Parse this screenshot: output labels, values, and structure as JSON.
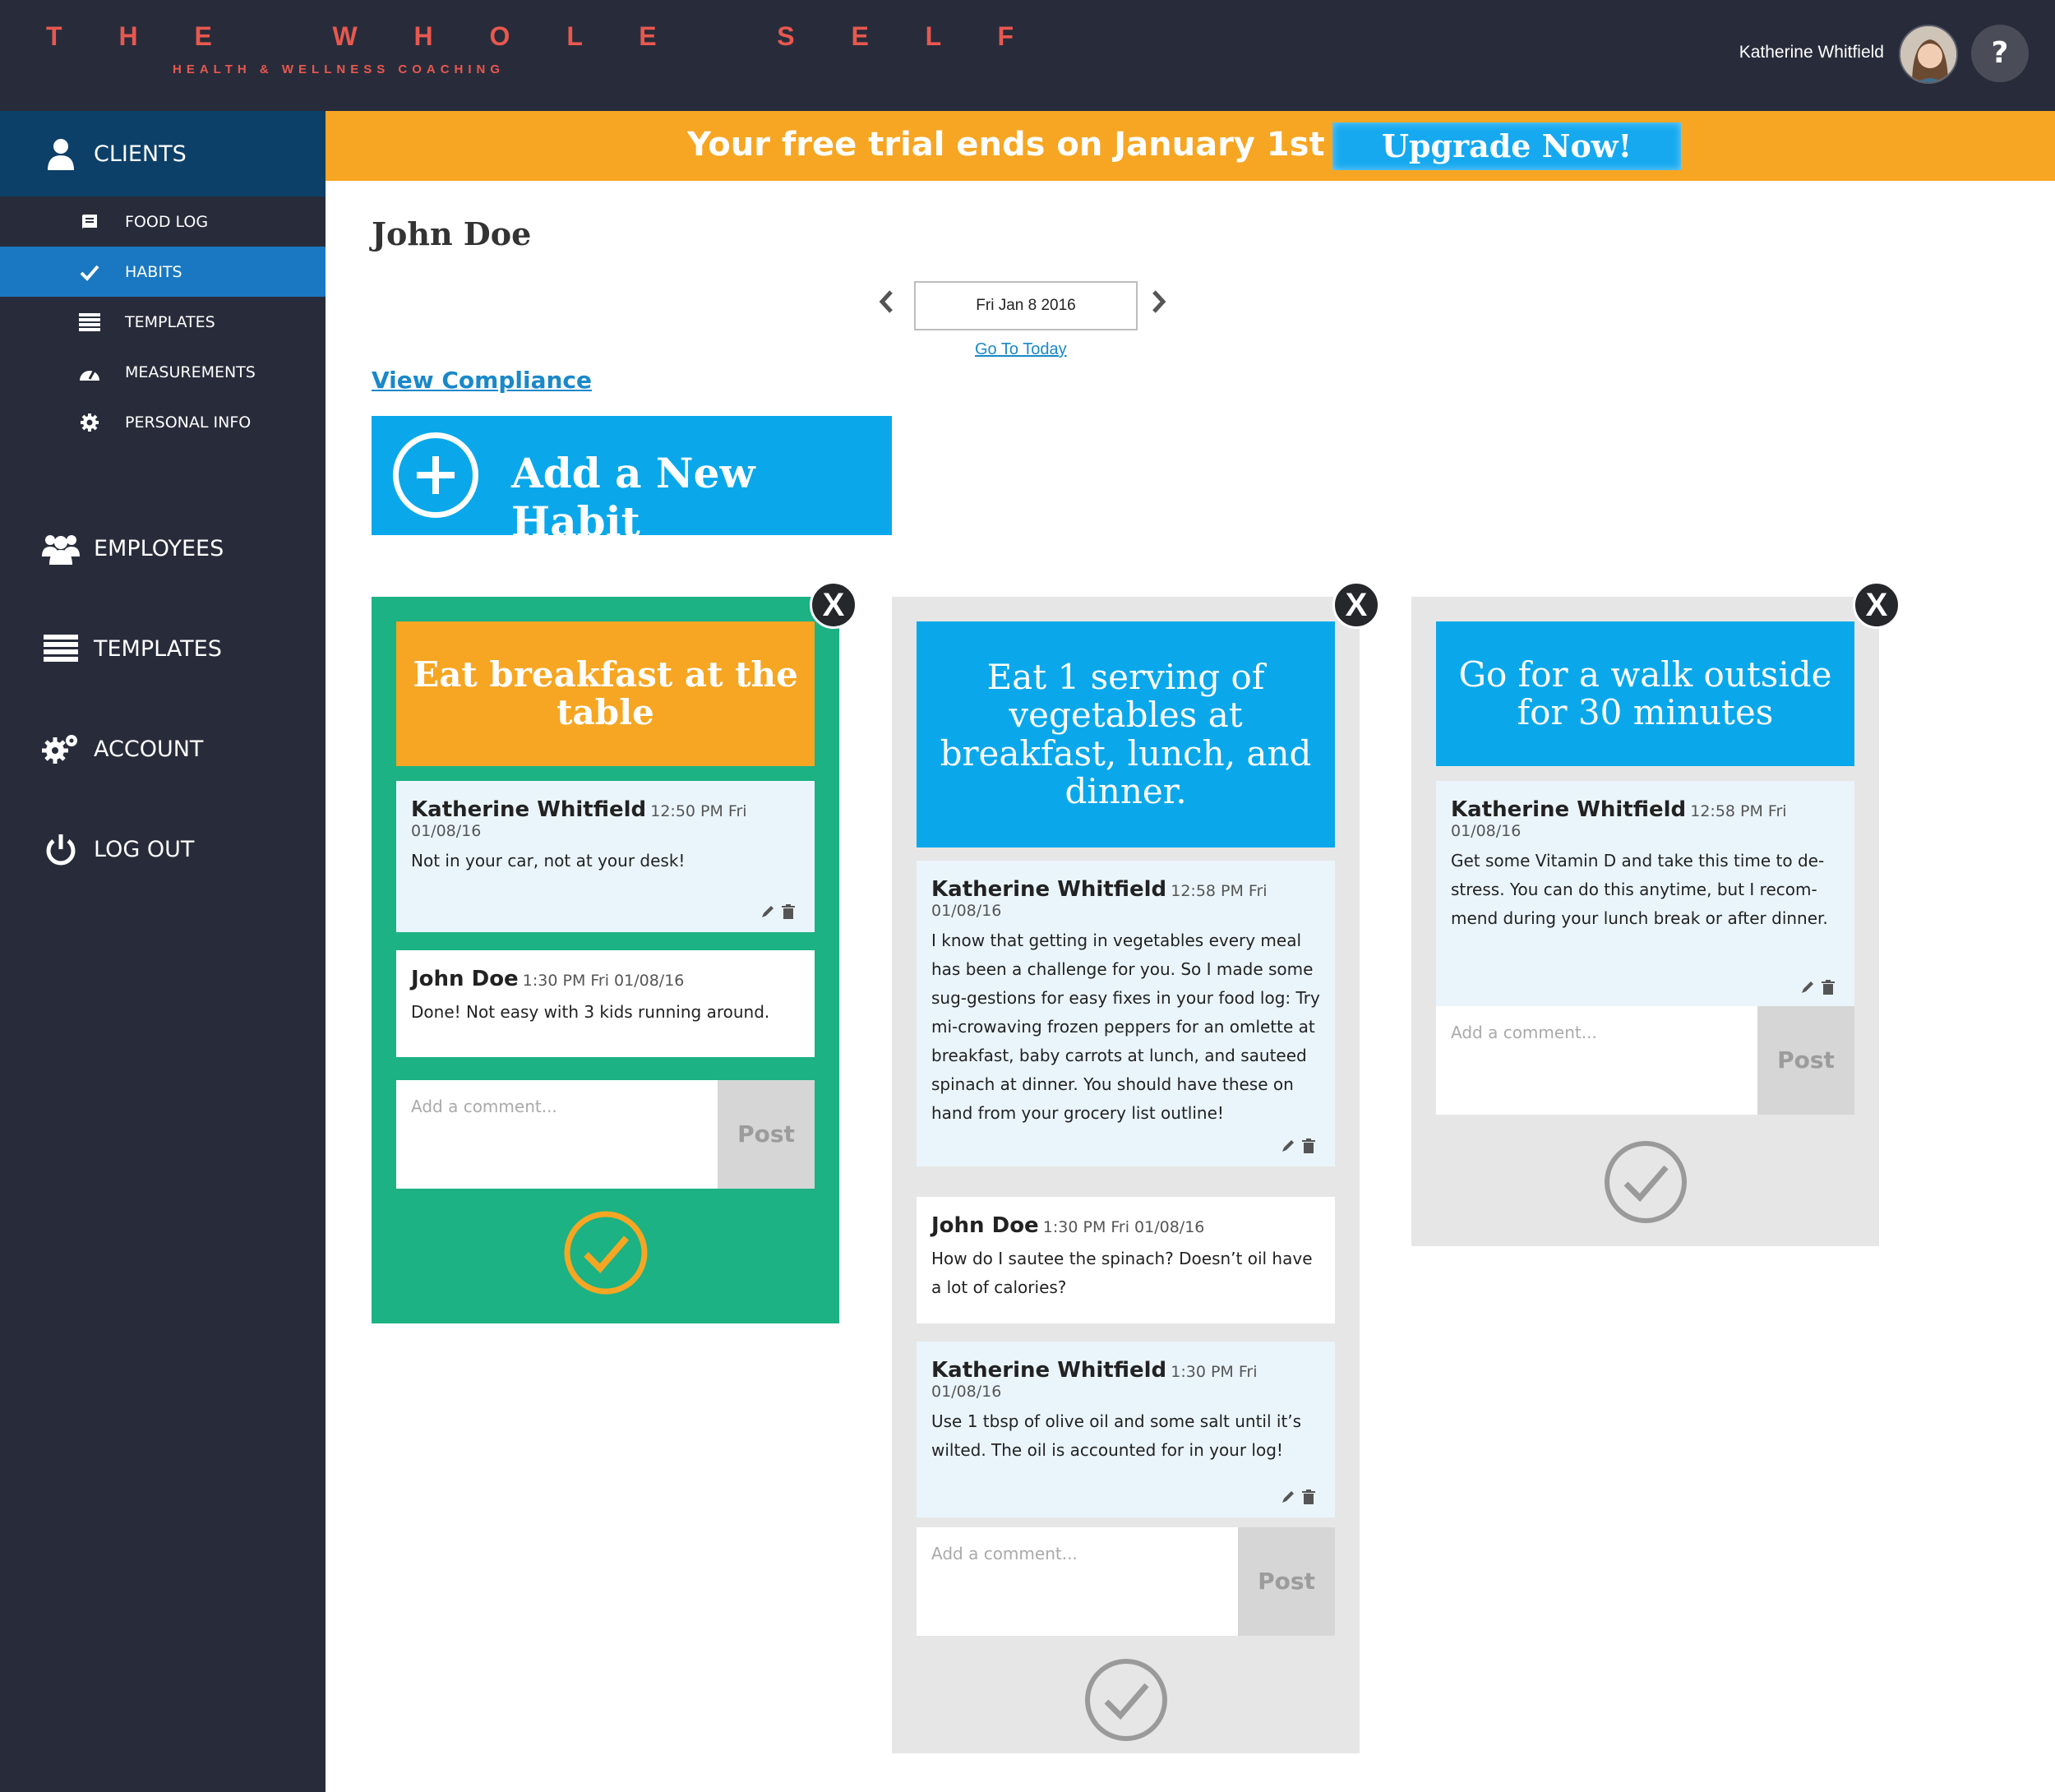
{
  "header": {
    "logo_title": "T H E   W H O L E   S E L F",
    "logo_subtitle": "HEALTH & WELLNESS COACHING",
    "user_name": "Katherine Whitfield",
    "help_label": "?"
  },
  "sidebar": {
    "clients": "CLIENTS",
    "sub_items": [
      {
        "label": "FOOD LOG",
        "icon": "book-icon"
      },
      {
        "label": "HABITS",
        "icon": "check-icon"
      },
      {
        "label": "TEMPLATES",
        "icon": "list-icon"
      },
      {
        "label": "MEASUREMENTS",
        "icon": "gauge-icon"
      },
      {
        "label": "PERSONAL INFO",
        "icon": "gear-icon"
      }
    ],
    "employees": "EMPLOYEES",
    "templates": "TEMPLATES",
    "account": "ACCOUNT",
    "logout": "LOG OUT"
  },
  "banner": {
    "trial_text": "Your free trial ends on January 1st",
    "upgrade_label": "Upgrade Now!"
  },
  "main": {
    "client_name": "John Doe",
    "date": "Fri Jan 8 2016",
    "go_today": "Go To Today",
    "view_compliance": "View Compliance",
    "add_habit": "Add a New Habit"
  },
  "habits": [
    {
      "title": "Eat breakfast at the table",
      "completed": true,
      "comments": [
        {
          "author": "Katherine Whitfield",
          "time": "12:50 PM Fri 01/08/16",
          "text": "Not in your car, not at your desk!"
        },
        {
          "author": "John Doe",
          "time": "1:30 PM Fri 01/08/16",
          "text": "Done! Not easy with 3 kids running around."
        }
      ],
      "comment_placeholder": "Add a comment...",
      "post_label": "Post"
    },
    {
      "title": "Eat 1 serving of vegetables at breakfast, lunch, and dinner.",
      "completed": false,
      "comments": [
        {
          "author": "Katherine Whitfield",
          "time": "12:58 PM Fri 01/08/16",
          "text": "I know that getting in vegetables every meal has been a challenge for you. So I made some sug-gestions for easy fixes in your food log: Try mi-crowaving frozen peppers for an omlette at breakfast, baby carrots at lunch, and sauteed spinach at dinner. You should have these on hand from your grocery list outline!"
        },
        {
          "author": "John Doe",
          "time": "1:30 PM Fri 01/08/16",
          "text": "How do I sautee the spinach? Doesn’t oil have a lot of calories?"
        },
        {
          "author": "Katherine Whitfield",
          "time": "1:30 PM Fri 01/08/16",
          "text": "Use 1 tbsp of olive oil and some salt until it’s wilted. The oil is accounted for in your log!"
        }
      ],
      "comment_placeholder": "Add a comment...",
      "post_label": "Post"
    },
    {
      "title": "Go for a walk outside for 30 minutes",
      "completed": false,
      "comments": [
        {
          "author": "Katherine Whitfield",
          "time": "12:58 PM Fri 01/08/16",
          "text": "Get some Vitamin D and take this time to de-stress. You can do this anytime, but I recom-mend during your lunch break or after dinner."
        }
      ],
      "comment_placeholder": "Add a comment...",
      "post_label": "Post"
    }
  ],
  "colors": {
    "dark": "#282c3a",
    "accent_orange": "#f6a623",
    "accent_blue": "#0aa8ea",
    "green": "#1cb283",
    "gray_card": "#e6e6e6"
  }
}
